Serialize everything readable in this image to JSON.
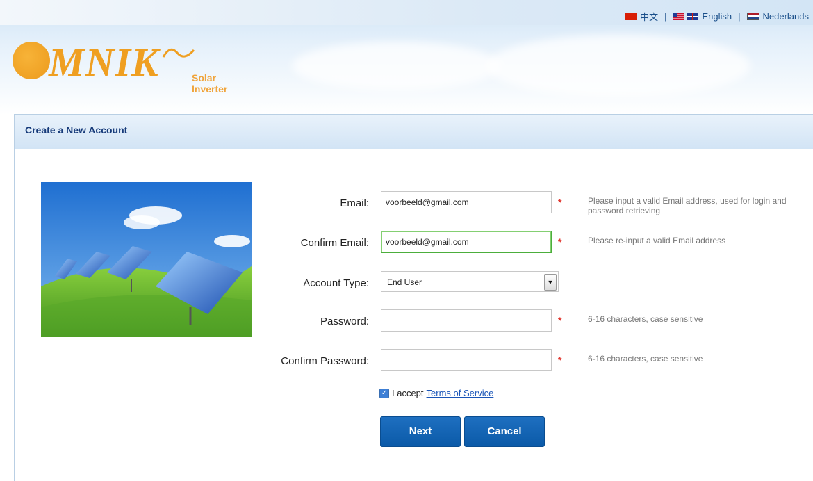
{
  "languages": {
    "chinese": "中文",
    "english": "English",
    "dutch": "Nederlands",
    "separator": "|"
  },
  "brand": {
    "word": "MNIK",
    "tagline": "Solar Inverter",
    "logo_color": "#ef9f21"
  },
  "panel": {
    "title": "Create a New Account"
  },
  "form": {
    "email": {
      "label": "Email:",
      "value": "voorbeeld@gmail.com",
      "required": "*",
      "hint": "Please input a valid Email address, used for login and password retrieving"
    },
    "confirm_email": {
      "label": "Confirm Email:",
      "value": "voorbeeld@gmail.com",
      "required": "*",
      "hint": "Please re-input a valid Email address"
    },
    "account_type": {
      "label": "Account Type:",
      "selected": "End User"
    },
    "password": {
      "label": "Password:",
      "value": "",
      "required": "*",
      "hint": "6-16 characters, case sensitive"
    },
    "confirm_password": {
      "label": "Confirm Password:",
      "value": "",
      "required": "*",
      "hint": "6-16 characters, case sensitive"
    },
    "accept_text": "I accept",
    "terms_link": "Terms of Service",
    "terms_checked": true
  },
  "buttons": {
    "next": "Next",
    "cancel": "Cancel"
  },
  "colors": {
    "accent": "#0b5aa8",
    "title": "#173b7a",
    "required": "#e0322a",
    "focus_border": "#4cae3c"
  }
}
